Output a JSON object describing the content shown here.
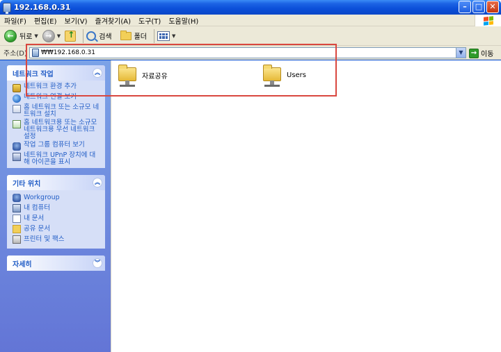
{
  "window": {
    "title": "192.168.0.31"
  },
  "menubar": {
    "items": [
      "파일(F)",
      "편집(E)",
      "보기(V)",
      "즐겨찾기(A)",
      "도구(T)",
      "도움말(H)"
    ]
  },
  "toolbar": {
    "back_label": "뒤로",
    "search_label": "검색",
    "folders_label": "폴더"
  },
  "address": {
    "label": "주소(D)",
    "value": "₩₩192.168.0.31",
    "go_label": "이동"
  },
  "task_panels": {
    "network": {
      "title": "네트워크 작업",
      "items": [
        "네트워크 환경 추가",
        "네트워크 연결 보기",
        "홈 네트워크 또는 소규모 네트워크 설치",
        "홈 네트워크용 또는 소규모 네트워크용 무선 네트워크 설정",
        "작업 그룹 컴퓨터 보기",
        "네트워크 UPnP 장치에 대해 아이콘을 표시"
      ]
    },
    "other": {
      "title": "기타 위치",
      "items": [
        "Workgroup",
        "내 컴퓨터",
        "내 문서",
        "공유 문서",
        "프린터 및 팩스"
      ]
    },
    "details": {
      "title": "자세히"
    }
  },
  "shares": [
    {
      "name": "자료공유"
    },
    {
      "name": "Users"
    }
  ]
}
